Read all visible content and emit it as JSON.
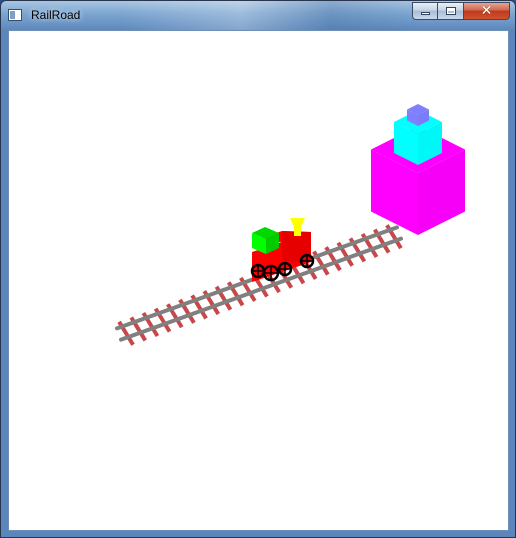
{
  "window": {
    "title": "RailRoad"
  },
  "caption_buttons": {
    "minimize_icon": "minimize-icon",
    "maximize_icon": "maximize-icon",
    "close_icon": "close-icon",
    "close_glyph": "✕"
  },
  "scene": {
    "background": "#ffffff",
    "colors": {
      "rail": "#808080",
      "tie": "#c8474a",
      "train_body": "#ff0000",
      "train_cab": "#00ff00",
      "chimney": "#ffff00",
      "wheels": "#000000",
      "big_cube": "#ff00ff",
      "mid_cube": "#00ffff",
      "small_cube": "#8080ff"
    },
    "tie_count": 23
  }
}
